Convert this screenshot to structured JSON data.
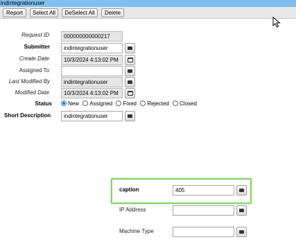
{
  "window": {
    "title": "indintegrationuser"
  },
  "toolbar": {
    "report_label": "Report",
    "select_all_label": "Select All",
    "deselect_all_label": "DeSelect All",
    "delete_label": "Delete"
  },
  "form": {
    "request_id": {
      "label": "Request ID",
      "value": "000000000000217"
    },
    "submitter": {
      "label": "Submitter",
      "value": "indintegrationuser"
    },
    "create_date": {
      "label": "Create Date",
      "value": "10/3/2024 4:13:02 PM"
    },
    "assigned_to": {
      "label": "Assigned To",
      "value": ""
    },
    "last_modified_by": {
      "label": "Last Modified By",
      "value": "indintegrationuser"
    },
    "modified_date": {
      "label": "Modified Date",
      "value": "10/3/2024 4:13:02 PM"
    },
    "status": {
      "label": "Status",
      "options": [
        "New",
        "Assigned",
        "Fixed",
        "Rejected",
        "Closed"
      ],
      "selected": "New"
    },
    "short_description": {
      "label": "Short Description",
      "value": "indintegrationuser"
    },
    "caption": {
      "label": "caption",
      "value": "405"
    },
    "ip_address": {
      "label": "IP Address",
      "value": ""
    },
    "machine_type": {
      "label": "Machine Type",
      "value": ""
    }
  },
  "colors": {
    "titlebar": "#7fbff0",
    "highlight": "#7fd45e",
    "radio_selected": "#1e72d8",
    "readonly_field": "#e6e6e6"
  }
}
